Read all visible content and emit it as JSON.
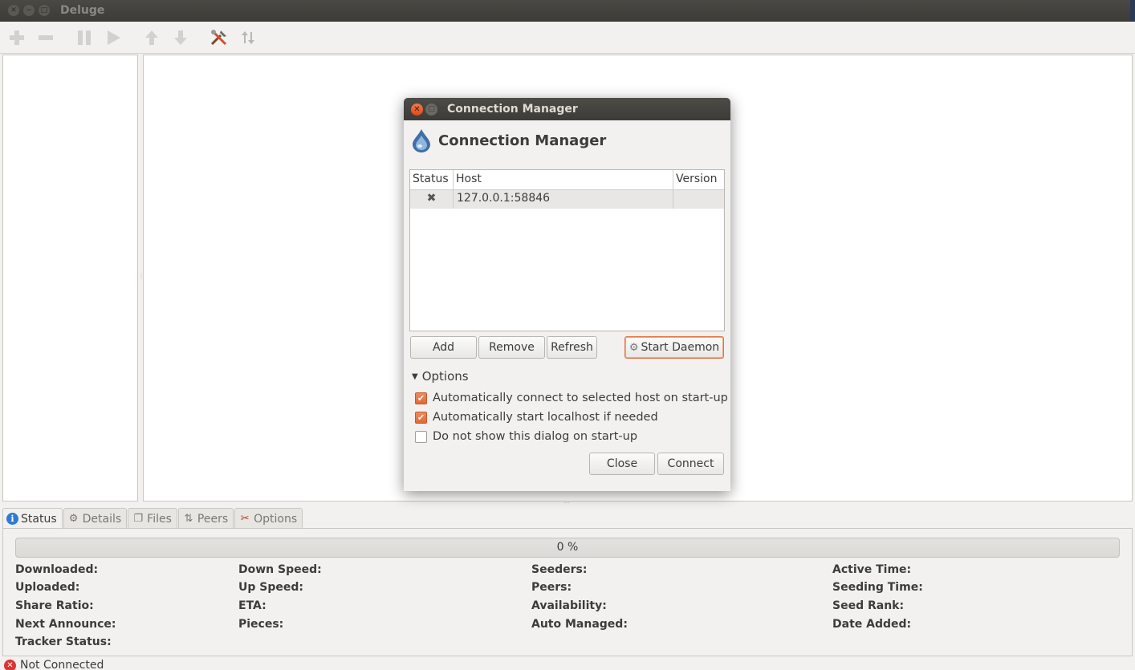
{
  "window": {
    "title": "Deluge"
  },
  "toolbar": {
    "icons": [
      "add-torrent-icon",
      "remove-torrent-icon",
      "pause-icon",
      "resume-icon",
      "queue-up-icon",
      "queue-down-icon",
      "preferences-icon",
      "connection-manager-icon"
    ]
  },
  "tabs": [
    {
      "label": "Status",
      "icon": "info-icon"
    },
    {
      "label": "Details",
      "icon": "gear-icon"
    },
    {
      "label": "Files",
      "icon": "files-icon"
    },
    {
      "label": "Peers",
      "icon": "peers-icon"
    },
    {
      "label": "Options",
      "icon": "tools-icon"
    }
  ],
  "status": {
    "progress_text": "0 %",
    "progress_fraction": 0,
    "col1": [
      "Downloaded:",
      "Uploaded:",
      "Share Ratio:",
      "Next Announce:",
      "Tracker Status:"
    ],
    "col2": [
      "Down Speed:",
      "Up Speed:",
      "ETA:",
      "Pieces:"
    ],
    "col3": [
      "Seeders:",
      "Peers:",
      "Availability:",
      "Auto Managed:"
    ],
    "col4": [
      "Active Time:",
      "Seeding Time:",
      "Seed Rank:",
      "Date Added:"
    ]
  },
  "statusbar": {
    "text": "Not Connected"
  },
  "dialog": {
    "title": "Connection Manager",
    "heading": "Connection Manager",
    "table": {
      "headers": [
        "Status",
        "Host",
        "Version"
      ],
      "rows": [
        {
          "status": "✖",
          "host": "127.0.0.1:58846",
          "version": ""
        }
      ]
    },
    "buttons": {
      "add": "Add",
      "remove": "Remove",
      "refresh": "Refresh",
      "start_daemon": "Start Daemon",
      "close": "Close",
      "connect": "Connect"
    },
    "options_label": "Options",
    "options": [
      {
        "label": "Automatically connect to selected host on start-up",
        "checked": true
      },
      {
        "label": "Automatically start localhost if needed",
        "checked": true
      },
      {
        "label": "Do not show this dialog on start-up",
        "checked": false
      }
    ]
  }
}
